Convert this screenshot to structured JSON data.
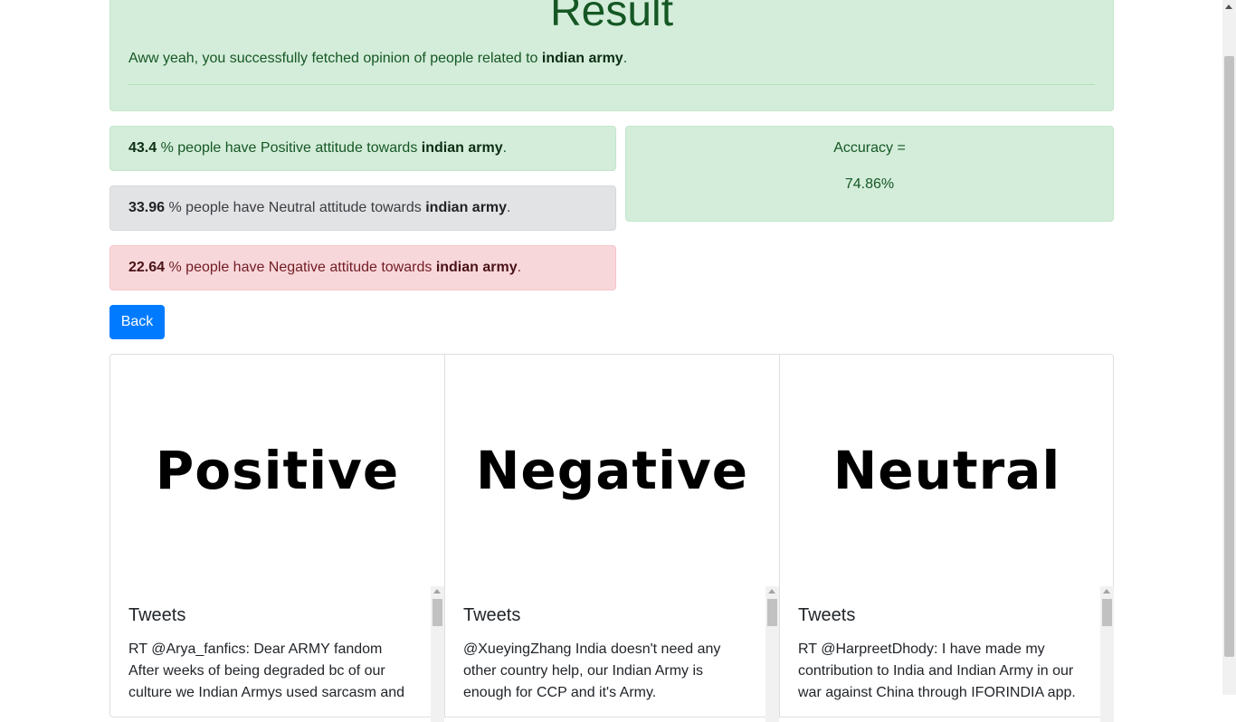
{
  "result": {
    "title": "Result",
    "message_prefix": "Aww yeah, you successfully fetched opinion of people related to",
    "topic": "indian army",
    "message_suffix": "."
  },
  "stats": {
    "positive": {
      "percent": "43.4",
      "text": "% people have Positive attitude towards",
      "topic": "indian army",
      "suffix": "."
    },
    "neutral": {
      "percent": "33.96",
      "text": "% people have Neutral attitude towards",
      "topic": "indian army",
      "suffix": "."
    },
    "negative": {
      "percent": "22.64",
      "text": "% people have Negative attitude towards",
      "topic": "indian army",
      "suffix": "."
    }
  },
  "accuracy": {
    "label": "Accuracy =",
    "value": "74.86%"
  },
  "back_button": "Back",
  "cards": [
    {
      "image_text": "Positive",
      "title": "Tweets",
      "text": "RT @Arya_fanfics: Dear ARMY fandom After weeks of being degraded bc of our culture we Indian Armys used sarcasm and"
    },
    {
      "image_text": "Negative",
      "title": "Tweets",
      "text": "@XueyingZhang India doesn't need any other country help, our Indian Army is enough for CCP and it's Army."
    },
    {
      "image_text": "Neutral",
      "title": "Tweets",
      "text": "RT @HarpreetDhody: I have made my contribution to India and Indian Army in our war against China through IFORINDIA app."
    }
  ],
  "colors": {
    "primary": "#007bff",
    "success_bg": "#d4edda",
    "success_text": "#155724",
    "danger_bg": "#f8d7da",
    "secondary_bg": "#e2e3e5"
  }
}
